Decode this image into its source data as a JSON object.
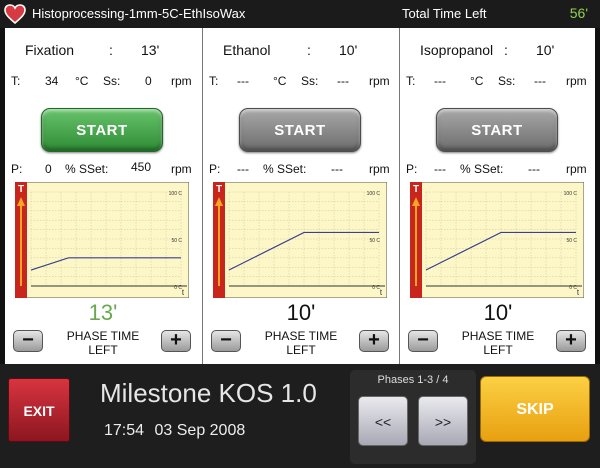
{
  "header": {
    "program": "Histoprocessing-1mm-5C-EthIsoWax",
    "total_time_label": "Total Time Left",
    "total_time_value": "56'"
  },
  "phases": [
    {
      "name": "Fixation",
      "colon": ":",
      "time": "13'",
      "t_label": "T:",
      "t_value": "34",
      "t_unit": "°C",
      "ss_label": "Ss:",
      "ss_value": "0",
      "ss_unit": "rpm",
      "start_label": "START",
      "p_label": "P:",
      "p_value": "0",
      "sset_label": "% SSet:",
      "sset_value": "450",
      "sset_unit": "rpm",
      "remaining": "13'",
      "phase_time_label": "PHASE TIME",
      "phase_time_label2": "LEFT",
      "minus": "−",
      "plus": "+",
      "status": "active"
    },
    {
      "name": "Ethanol",
      "colon": ":",
      "time": "10'",
      "t_label": "T:",
      "t_value": "---",
      "t_unit": "°C",
      "ss_label": "Ss:",
      "ss_value": "---",
      "ss_unit": "rpm",
      "start_label": "START",
      "p_label": "P:",
      "p_value": "---",
      "sset_label": "% SSet:",
      "sset_value": "---",
      "sset_unit": "rpm",
      "remaining": "10'",
      "phase_time_label": "PHASE TIME",
      "phase_time_label2": "LEFT",
      "minus": "−",
      "plus": "+",
      "status": "inactive"
    },
    {
      "name": "Isopropanol",
      "colon": ":",
      "time": "10'",
      "t_label": "T:",
      "t_value": "---",
      "t_unit": "°C",
      "ss_label": "Ss:",
      "ss_value": "---",
      "ss_unit": "rpm",
      "start_label": "START",
      "p_label": "P:",
      "p_value": "---",
      "sset_label": "% SSet:",
      "sset_value": "---",
      "sset_unit": "rpm",
      "remaining": "10'",
      "phase_time_label": "PHASE TIME",
      "phase_time_label2": "LEFT",
      "minus": "−",
      "plus": "+",
      "status": "inactive"
    }
  ],
  "chart_data": [
    {
      "type": "line",
      "y_axis_badge": "T",
      "x_axis_badge": "t",
      "y_ticks": [
        "100 C",
        "50 C",
        "0 C"
      ],
      "ylim": [
        0,
        100
      ],
      "xlim": [
        0,
        100
      ],
      "series": [
        {
          "x": [
            0,
            25,
            100
          ],
          "y": [
            17,
            30,
            30
          ]
        }
      ]
    },
    {
      "type": "line",
      "y_axis_badge": "T",
      "x_axis_badge": "t",
      "y_ticks": [
        "100 C",
        "50 C",
        "0 C"
      ],
      "ylim": [
        0,
        100
      ],
      "xlim": [
        0,
        100
      ],
      "series": [
        {
          "x": [
            0,
            50,
            100
          ],
          "y": [
            17,
            57,
            57
          ]
        }
      ]
    },
    {
      "type": "line",
      "y_axis_badge": "T",
      "x_axis_badge": "t",
      "y_ticks": [
        "100 C",
        "50 C",
        "0 C"
      ],
      "ylim": [
        0,
        100
      ],
      "xlim": [
        0,
        100
      ],
      "series": [
        {
          "x": [
            0,
            50,
            100
          ],
          "y": [
            17,
            57,
            57
          ]
        }
      ]
    }
  ],
  "footer": {
    "exit_label": "EXIT",
    "brand": "Milestone KOS 1.0",
    "time": "17:54",
    "date": "03 Sep 2008",
    "phases_label": "Phases 1-3 / 4",
    "prev_label": "<<",
    "next_label": ">>",
    "skip_label": "SKIP"
  },
  "colors": {
    "start_active": "#3fa046",
    "start_inactive": "#8a8a8a",
    "exit": "#c12733",
    "skip": "#f2b21e",
    "chart_bg": "#fdf7c8",
    "chart_badge": "#c8261d",
    "remaining_active": "#6aa84f"
  },
  "icons": {
    "app": "heart-icon"
  }
}
